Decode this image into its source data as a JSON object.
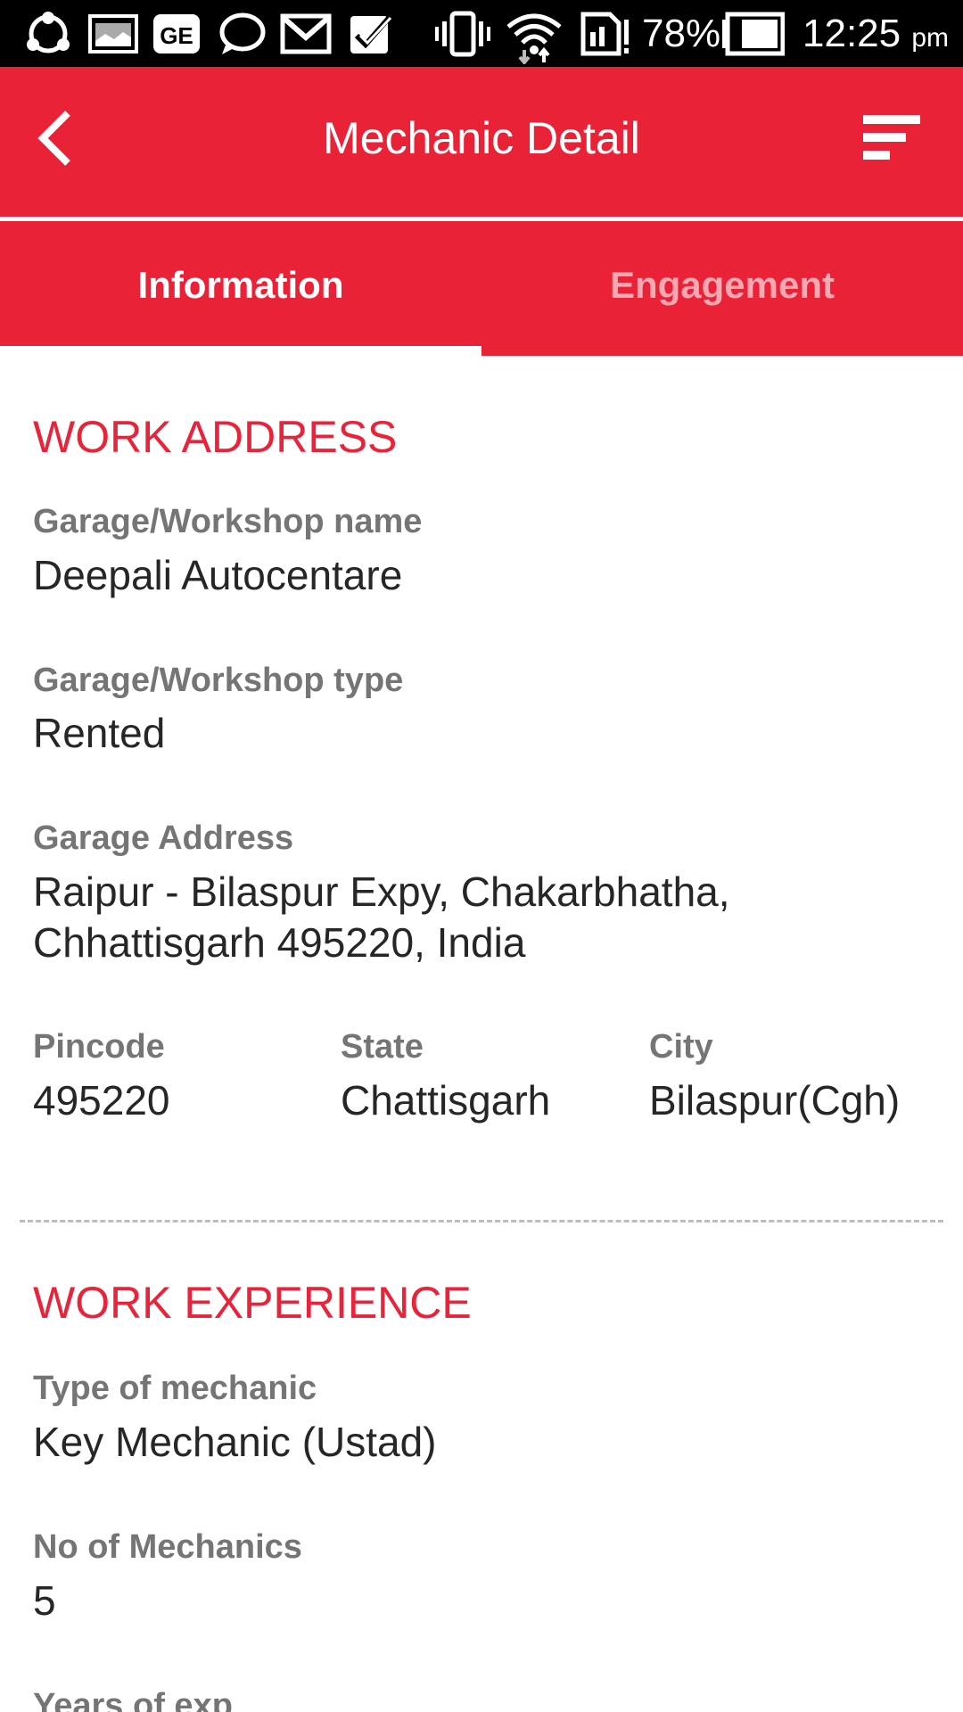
{
  "status_bar": {
    "battery_percent": "78%",
    "time": "12:25",
    "time_suffix": "pm",
    "icons": [
      "share-icon",
      "image-icon",
      "ge-icon",
      "chat-icon",
      "gmail-icon",
      "task-icon",
      "vibrate-icon",
      "wifi-icon",
      "sim-icon",
      "battery-icon"
    ]
  },
  "app_bar": {
    "title": "Mechanic Detail",
    "back_icon": "chevron-left-icon",
    "menu_icon": "filter-menu-icon",
    "background": "#ea2238"
  },
  "tabs": [
    {
      "label": "Information",
      "selected": true
    },
    {
      "label": "Engagement",
      "selected": false
    }
  ],
  "work_address": {
    "title": "WORK ADDRESS",
    "garage_name_label": "Garage/Workshop name",
    "garage_name_value": "Deepali Autocentare",
    "garage_type_label": "Garage/Workshop type",
    "garage_type_value": "Rented",
    "garage_address_label": "Garage Address",
    "garage_address_line1": "Raipur - Bilaspur Expy, Chakarbhatha,",
    "garage_address_line2": "Chhattisgarh 495220, India",
    "pincode_label": "Pincode",
    "pincode_value": "495220",
    "state_label": "State",
    "state_value": "Chattisgarh",
    "city_label": "City",
    "city_value": "Bilaspur(Cgh)"
  },
  "work_experience": {
    "title": "WORK EXPERIENCE",
    "mechanic_type_label": "Type of mechanic",
    "mechanic_type_value": "Key Mechanic (Ustad)",
    "num_mechanics_label": "No of Mechanics",
    "num_mechanics_value": "5",
    "years_exp_label": "Years of exp"
  },
  "colors": {
    "accent": "#ea2238",
    "section_title": "#e8233a",
    "label": "#757575",
    "value": "#262626"
  }
}
